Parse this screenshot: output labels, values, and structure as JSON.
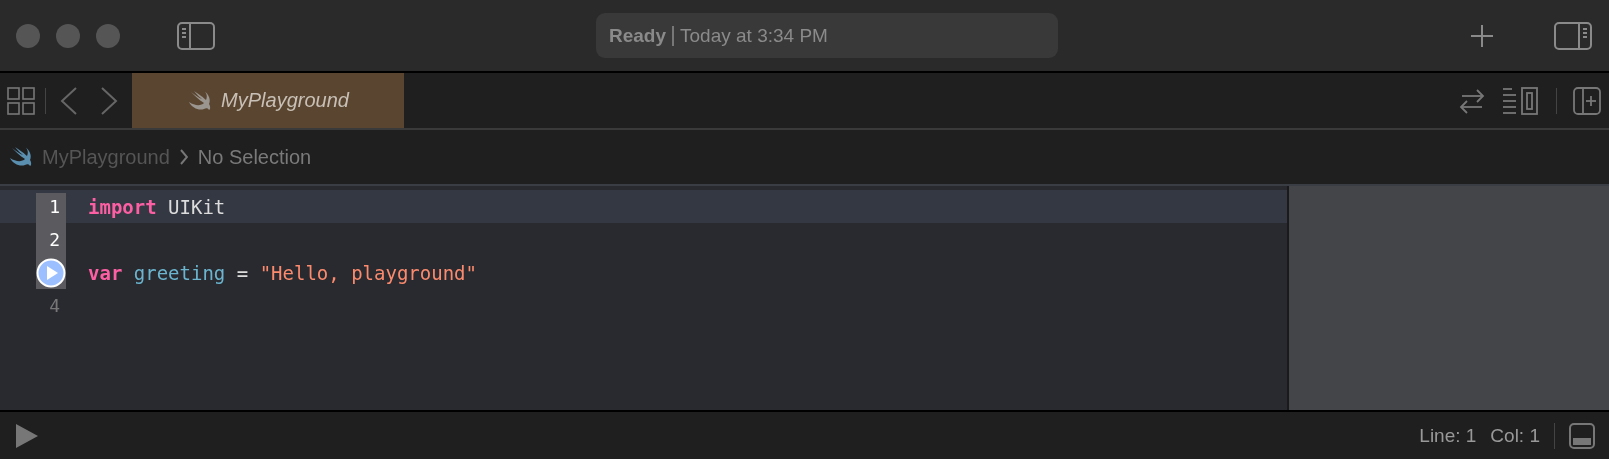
{
  "toolbar": {
    "status": {
      "state": "Ready",
      "time": "Today at 3:34 PM"
    }
  },
  "tabs": [
    {
      "label": "MyPlayground",
      "selected": true
    }
  ],
  "breadcrumb": {
    "file": "MyPlayground",
    "selection": "No Selection"
  },
  "editor": {
    "lines": [
      {
        "kind": "number",
        "number": "1",
        "current": true,
        "in_run_range": true,
        "tokens": [
          {
            "kind": "keyword",
            "text": "import"
          },
          {
            "kind": "plain",
            "text": "UIKit"
          }
        ]
      },
      {
        "kind": "number",
        "number": "2",
        "current": false,
        "in_run_range": true
      },
      {
        "kind": "run_button",
        "current": false,
        "in_run_range": true,
        "tokens": [
          {
            "kind": "keyword",
            "text": "var"
          },
          {
            "kind": "identifier",
            "text": "greeting"
          },
          {
            "kind": "plain",
            "text": "="
          },
          {
            "kind": "string",
            "text": "\"Hello, playground\""
          }
        ]
      },
      {
        "kind": "number",
        "number": "4",
        "current": false,
        "in_run_range": false
      }
    ]
  },
  "status_bar": {
    "line": "Line: 1",
    "col": "Col: 1"
  }
}
